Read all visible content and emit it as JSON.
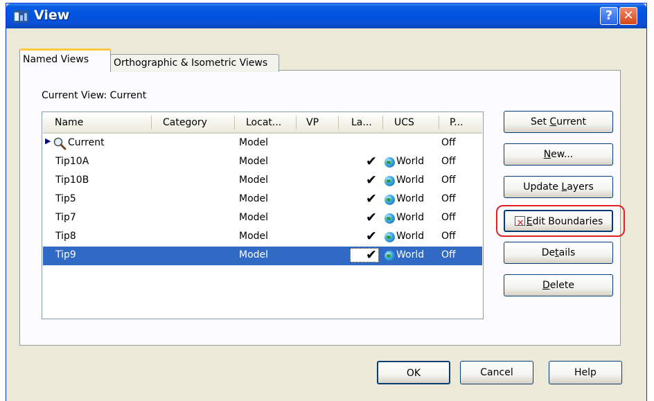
{
  "window": {
    "title": "View",
    "help_glyph": "?",
    "close_glyph": "✕",
    "titlebar_color": "#0054e3"
  },
  "tabs": [
    {
      "label": "Named Views",
      "active": true
    },
    {
      "label": "Orthographic & Isometric Views",
      "active": false
    }
  ],
  "current_view": {
    "label": "Current View:",
    "value": "Current"
  },
  "list": {
    "columns": [
      "Name",
      "Category",
      "Locat...",
      "VP",
      "La...",
      "UCS",
      "P..."
    ],
    "rows": [
      {
        "name": "Current",
        "category": "",
        "location": "Model",
        "vp": "",
        "layers_check": "",
        "ucs": "",
        "persp": "Off",
        "icon": "magnifier-icon",
        "pointer": "▶",
        "selected": false
      },
      {
        "name": "Tip10A",
        "category": "",
        "location": "Model",
        "vp": "",
        "layers_check": "✔",
        "ucs": "World",
        "persp": "Off",
        "icon": "globe-icon",
        "selected": false
      },
      {
        "name": "Tip10B",
        "category": "",
        "location": "Model",
        "vp": "",
        "layers_check": "✔",
        "ucs": "World",
        "persp": "Off",
        "icon": "globe-icon",
        "selected": false
      },
      {
        "name": "Tip5",
        "category": "",
        "location": "Model",
        "vp": "",
        "layers_check": "✔",
        "ucs": "World",
        "persp": "Off",
        "icon": "globe-icon",
        "selected": false
      },
      {
        "name": "Tip7",
        "category": "",
        "location": "Model",
        "vp": "",
        "layers_check": "✔",
        "ucs": "World",
        "persp": "Off",
        "icon": "globe-icon",
        "selected": false
      },
      {
        "name": "Tip8",
        "category": "",
        "location": "Model",
        "vp": "",
        "layers_check": "✔",
        "ucs": "World",
        "persp": "Off",
        "icon": "globe-icon",
        "selected": false
      },
      {
        "name": "Tip9",
        "category": "",
        "location": "Model",
        "vp": "",
        "layers_check": "✔",
        "ucs": "World",
        "persp": "Off",
        "icon": "globe-icon",
        "selected": true
      }
    ],
    "selection_color": "#316ac5"
  },
  "side_buttons": {
    "set_current": {
      "pre": "Set ",
      "u": "C",
      "post": "urrent"
    },
    "new": {
      "pre": "",
      "u": "N",
      "post": "ew..."
    },
    "update_layers": {
      "pre": "Update ",
      "u": "L",
      "post": "ayers"
    },
    "edit_boundaries": {
      "pre": "",
      "u": "E",
      "post": "dit Boundaries"
    },
    "details": {
      "pre": "De",
      "u": "t",
      "post": "ails"
    },
    "delete": {
      "pre": "",
      "u": "D",
      "post": "elete"
    }
  },
  "footer_buttons": {
    "ok": "OK",
    "cancel": "Cancel",
    "help": "Help"
  },
  "annotation": {
    "highlight_color": "#e02020"
  }
}
